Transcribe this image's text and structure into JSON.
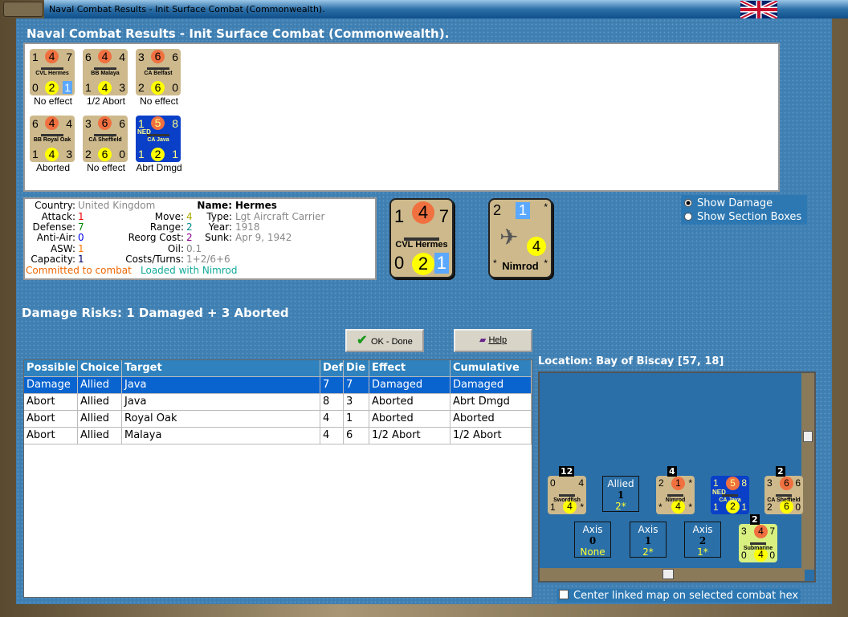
{
  "window": {
    "title": "Naval Combat Results - Init Surface Combat (Commonwealth)."
  },
  "header": "Naval Combat Results - Init Surface Combat (Commonwealth).",
  "units": [
    {
      "tl": "1",
      "tc": "4",
      "tr": "7",
      "name": "CVL Hermes",
      "bl": "0",
      "bc": "2",
      "br": "1",
      "color": "tan",
      "result": "No effect"
    },
    {
      "tl": "6",
      "tc": "4",
      "tr": "4",
      "name": "BB Malaya",
      "bl": "1",
      "bc": "4",
      "br": "3",
      "color": "tan",
      "result": "1/2 Abort"
    },
    {
      "tl": "3",
      "tc": "6",
      "tr": "6",
      "name": "CA Belfast",
      "bl": "2",
      "bc": "6",
      "br": "0",
      "color": "tan",
      "result": "No effect"
    },
    {
      "tl": "6",
      "tc": "4",
      "tr": "4",
      "name": "BB Royal Oak",
      "bl": "1",
      "bc": "4",
      "br": "3",
      "color": "tan",
      "result": "Aborted"
    },
    {
      "tl": "3",
      "tc": "6",
      "tr": "6",
      "name": "CA Sheffield",
      "bl": "2",
      "bc": "6",
      "br": "0",
      "color": "tan",
      "result": "No effect"
    },
    {
      "tl": "1",
      "tc": "5",
      "tr": "8",
      "name": "CA Java",
      "nation": "NED",
      "bl": "1",
      "bc": "2",
      "br": "1",
      "color": "blue",
      "result": "Abrt Dmgd"
    }
  ],
  "info": {
    "country_l": "Country:",
    "country": "United Kingdom",
    "attack_l": "Attack:",
    "attack": "1",
    "defense_l": "Defense:",
    "defense": "7",
    "aa_l": "Anti-Air:",
    "aa": "0",
    "asw_l": "ASW:",
    "asw": "1",
    "cap_l": "Capacity:",
    "cap": "1",
    "move_l": "Move:",
    "move": "4",
    "range_l": "Range:",
    "range": "2",
    "reorg_l": "Reorg Cost:",
    "reorg": "2",
    "oil_l": "Oil:",
    "oil": "0.1",
    "costs_l": "Costs/Turns:",
    "costs": "1+2/6+6",
    "name_l": "Name:",
    "name": "Hermes",
    "type_l": "Type:",
    "type": "Lgt Aircraft Carrier",
    "year_l": "Year:",
    "year": "1918",
    "sunk_l": "Sunk:",
    "sunk": "Apr 9, 1942",
    "committed": "Committed to combat",
    "loaded": "Loaded with Nimrod"
  },
  "big_ship": {
    "tl": "1",
    "tc": "4",
    "tr": "7",
    "name": "CVL Hermes",
    "bl": "0",
    "bc": "2",
    "br": "1"
  },
  "big_plane": {
    "tl": "2",
    "tc": "1",
    "tr": "*",
    "name": "Nimrod",
    "bl": "*",
    "bc": "4",
    "br": "*"
  },
  "options": {
    "show_damage": "Show Damage",
    "show_sections": "Show Section Boxes"
  },
  "risks": "Damage Risks: 1 Damaged + 3 Aborted",
  "buttons": {
    "ok": "OK - Done",
    "help": "Help"
  },
  "table": {
    "headers": [
      "Possible",
      "Choice",
      "Target",
      "Def",
      "Die",
      "Effect",
      "Cumulative"
    ],
    "rows": [
      [
        "Damage",
        "Allied",
        "Java",
        "7",
        "7",
        "Damaged",
        "Damaged"
      ],
      [
        "Abort",
        "Allied",
        "Java",
        "8",
        "3",
        "Aborted",
        "Abrt Dmgd"
      ],
      [
        "Abort",
        "Allied",
        "Royal Oak",
        "4",
        "1",
        "Aborted",
        "Aborted"
      ],
      [
        "Abort",
        "Allied",
        "Malaya",
        "4",
        "6",
        "1/2 Abort",
        "1/2 Abort"
      ]
    ]
  },
  "location": "Location:  Bay of Biscay [57, 18]",
  "map": {
    "swordfish": {
      "stack": "12",
      "tl": "0",
      "tr": "4",
      "bl": "1",
      "bc": "4",
      "name": "Swordfish",
      "br": "*"
    },
    "nimrod": {
      "stack": "4",
      "tl": "2",
      "tc": "1",
      "tr": "*",
      "bc": "4",
      "name": "Nimrod",
      "bl": "*",
      "br": "*"
    },
    "java": {
      "tl": "1",
      "tc": "5",
      "tr": "8",
      "nation": "NED",
      "name": "CA Java",
      "bl": "1",
      "bc": "2",
      "br": "1"
    },
    "sheffield": {
      "stack": "2",
      "tl": "3",
      "tc": "6",
      "tr": "6",
      "name": "CA Sheffield",
      "bl": "2",
      "bc": "6",
      "br": "0"
    },
    "submarine": {
      "stack": "2",
      "tl": "3",
      "tc": "4",
      "tr": "7",
      "name": "Submarine",
      "bl": "0",
      "bc": "4",
      "br": "0"
    },
    "boxes": [
      {
        "side": "Allied",
        "num": "1",
        "val": "2*"
      },
      {
        "side": "Axis",
        "num": "0",
        "val": "None"
      },
      {
        "side": "Axis",
        "num": "1",
        "val": "2*"
      },
      {
        "side": "Axis",
        "num": "2",
        "val": "1*"
      }
    ]
  },
  "center_map": "Center linked map on selected combat hex"
}
